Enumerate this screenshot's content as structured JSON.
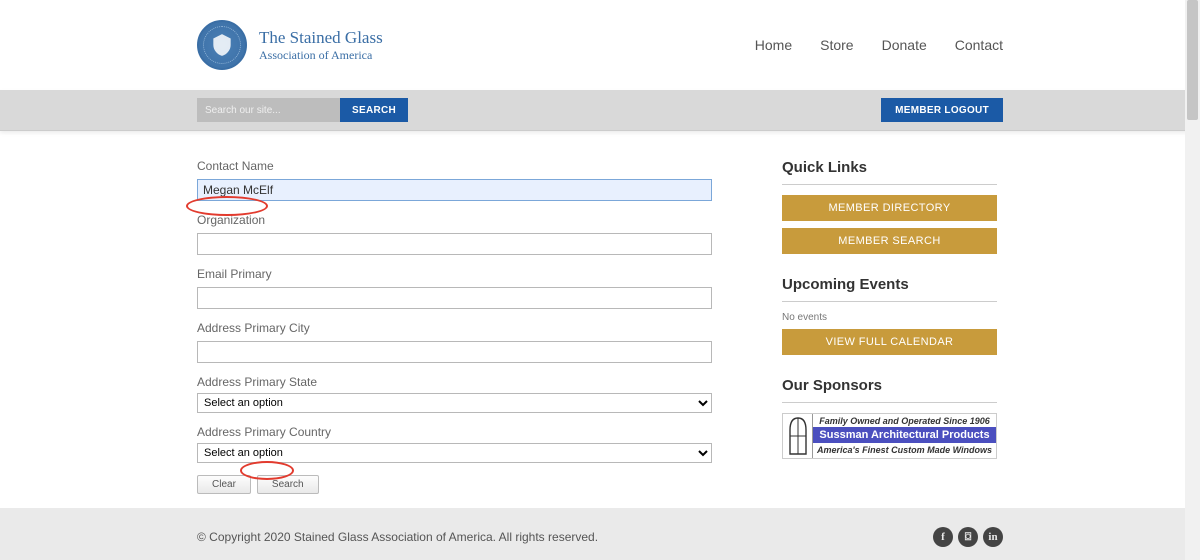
{
  "brand": {
    "line1": "The Stained Glass",
    "line2": "Association of America"
  },
  "nav": {
    "home": "Home",
    "store": "Store",
    "donate": "Donate",
    "contact": "Contact"
  },
  "utilbar": {
    "search_placeholder": "Search our site...",
    "search_button": "SEARCH",
    "logout": "MEMBER LOGOUT"
  },
  "form": {
    "contact_name_label": "Contact Name",
    "contact_name_value": "Megan McElf",
    "organization_label": "Organization",
    "organization_value": "",
    "email_label": "Email Primary",
    "email_value": "",
    "city_label": "Address Primary City",
    "city_value": "",
    "state_label": "Address Primary State",
    "state_option": "Select an option",
    "country_label": "Address Primary Country",
    "country_option": "Select an option",
    "clear": "Clear",
    "search": "Search"
  },
  "sidebar": {
    "quicklinks_heading": "Quick Links",
    "member_directory": "MEMBER DIRECTORY",
    "member_search": "MEMBER SEARCH",
    "events_heading": "Upcoming Events",
    "no_events": "No events",
    "view_calendar": "VIEW FULL CALENDAR",
    "sponsors_heading": "Our Sponsors",
    "sponsor": {
      "line1": "Family Owned and Operated Since 1906",
      "line2": "Sussman Architectural Products",
      "line3": "America's Finest Custom Made Windows"
    }
  },
  "footer": {
    "copyright": "© Copyright 2020 Stained Glass Association of America.  All rights reserved."
  },
  "icons": {
    "facebook": "f",
    "instagram": "⌼",
    "linkedin": "in"
  }
}
